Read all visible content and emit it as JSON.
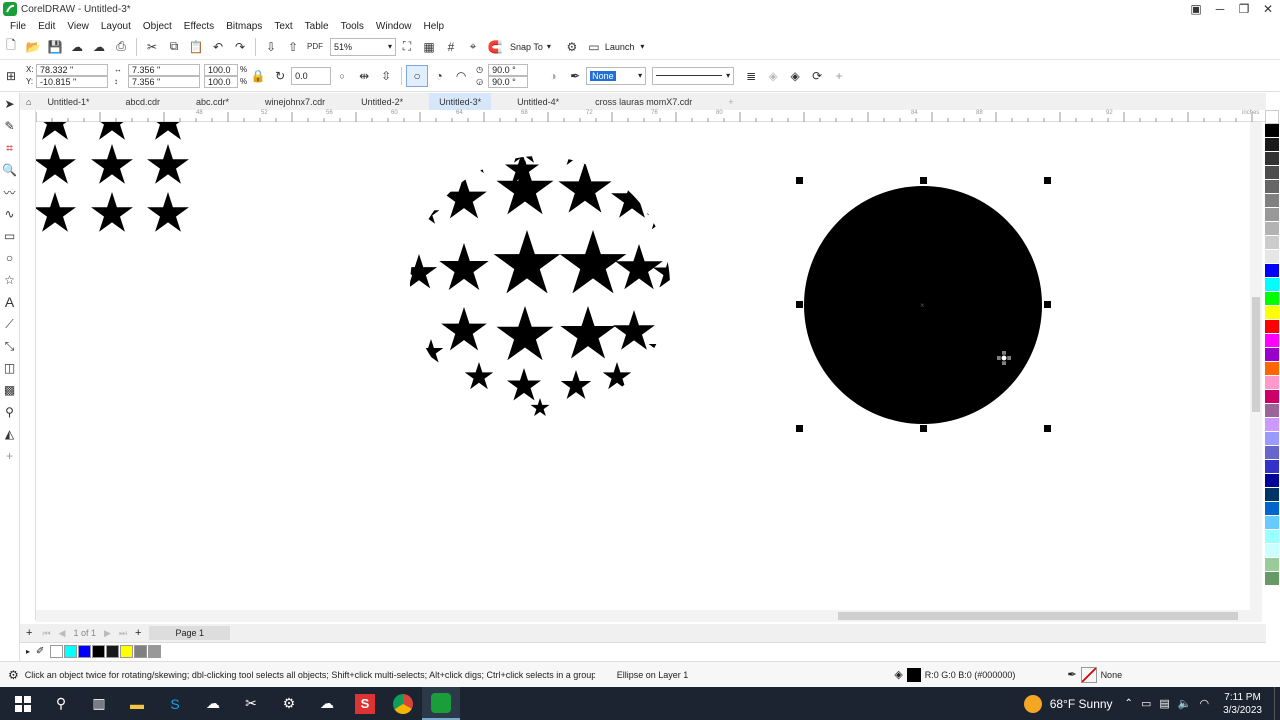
{
  "window": {
    "title": "CorelDRAW - Untitled-3*"
  },
  "menu": [
    "File",
    "Edit",
    "View",
    "Layout",
    "Object",
    "Effects",
    "Bitmaps",
    "Text",
    "Table",
    "Tools",
    "Window",
    "Help"
  ],
  "toolbar": {
    "zoom": "51%",
    "snap_to": "Snap To",
    "launch": "Launch"
  },
  "props": {
    "x": "78.332 \"",
    "y": "-10.815 \"",
    "width": "7.356 \"",
    "height": "7.356 \"",
    "scale_w": "100.0",
    "scale_h": "100.0",
    "pct": "%",
    "rotation": "0.0",
    "arc_start": "90.0 °",
    "arc_end": "90.0 °",
    "outline": "None"
  },
  "tabs": [
    {
      "label": "Untitled-1*"
    },
    {
      "label": "abcd.cdr"
    },
    {
      "label": "abc.cdr*"
    },
    {
      "label": "winejohnx7.cdr"
    },
    {
      "label": "Untitled-2*"
    },
    {
      "label": "Untitled-3*",
      "active": true
    },
    {
      "label": "Untitled-4*"
    },
    {
      "label": "cross lauras momX7.cdr"
    }
  ],
  "ruler_top_labels": [
    "48",
    "52",
    "56",
    "60",
    "64",
    "68",
    "72",
    "76",
    "80",
    "84",
    "88",
    "92",
    "inches"
  ],
  "pagebar": {
    "pages": "1 of 1",
    "page_tab": "Page 1"
  },
  "status": {
    "hint": "Click an object twice for rotating/skewing; dbl-clicking tool selects all objects; Shift+click multi-selects; Alt+click digs; Ctrl+click selects in a group",
    "object": "Ellipse on Layer 1",
    "fill": "R:0 G:0 B:0 (#000000)",
    "outline": "None"
  },
  "taskbar": {
    "weather": "68°F  Sunny",
    "time": "7:11 PM",
    "date": "3/3/2023"
  },
  "colors": {
    "palette": [
      "#ffffff",
      "#000000",
      "#1a1a1a",
      "#333333",
      "#4d4d4d",
      "#666666",
      "#808080",
      "#999999",
      "#b3b3b3",
      "#cccccc",
      "#e6e6e6",
      "#0000ff",
      "#00ffff",
      "#00ff00",
      "#ffff00",
      "#ff0000",
      "#ff00ff",
      "#9900cc",
      "#ff6600",
      "#ff99cc",
      "#cc0066",
      "#996699",
      "#cc99ff",
      "#9999ff",
      "#6666cc",
      "#3333cc",
      "#000099",
      "#003366",
      "#0066cc",
      "#66ccff",
      "#99ffff",
      "#ccffff",
      "#99cc99",
      "#669966"
    ],
    "docpalette": [
      "#ffffff",
      "#00ffff",
      "#0000ff",
      "#000000",
      "#1a1a1a",
      "#ffff00",
      "#808080",
      "#999999"
    ]
  }
}
